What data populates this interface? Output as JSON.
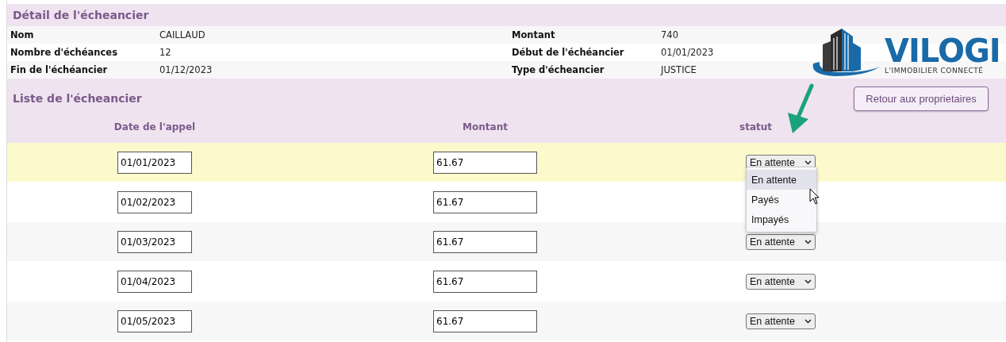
{
  "detail": {
    "title": "Détail de l'écheancier",
    "rows": [
      [
        {
          "label": "Nom",
          "value": "CAILLAUD"
        },
        {
          "label": "Montant",
          "value": "740"
        }
      ],
      [
        {
          "label": "Nombre d'échéances",
          "value": "12"
        },
        {
          "label": "Début de l'échéancier",
          "value": "01/01/2023"
        }
      ],
      [
        {
          "label": "Fin de l'échéancier",
          "value": "01/12/2023"
        },
        {
          "label": "Type d'écheancier",
          "value": "JUSTICE"
        }
      ]
    ]
  },
  "logo": {
    "name": "VILOGI",
    "tagline": "L'IMMOBILIER CONNECTÉ"
  },
  "list": {
    "title": "Liste de l'écheancier",
    "back_button": "Retour aux proprietaires",
    "columns": [
      "Date de l'appel",
      "Montant",
      "statut"
    ],
    "rows": [
      {
        "date": "01/01/2023",
        "amount": "61.67",
        "status": "En attente",
        "selected": true
      },
      {
        "date": "01/02/2023",
        "amount": "61.67",
        "selected": false
      },
      {
        "date": "01/03/2023",
        "amount": "61.67",
        "status": "En attente",
        "selected": false
      },
      {
        "date": "01/04/2023",
        "amount": "61.67",
        "status": "En attente",
        "selected": false
      },
      {
        "date": "01/05/2023",
        "amount": "61.67",
        "status": "En attente",
        "selected": false
      }
    ],
    "dropdown": {
      "options": [
        {
          "label": "En attente",
          "selected": true
        },
        {
          "label": "Payés",
          "selected": false
        },
        {
          "label": "Impayés",
          "selected": false
        }
      ]
    }
  }
}
